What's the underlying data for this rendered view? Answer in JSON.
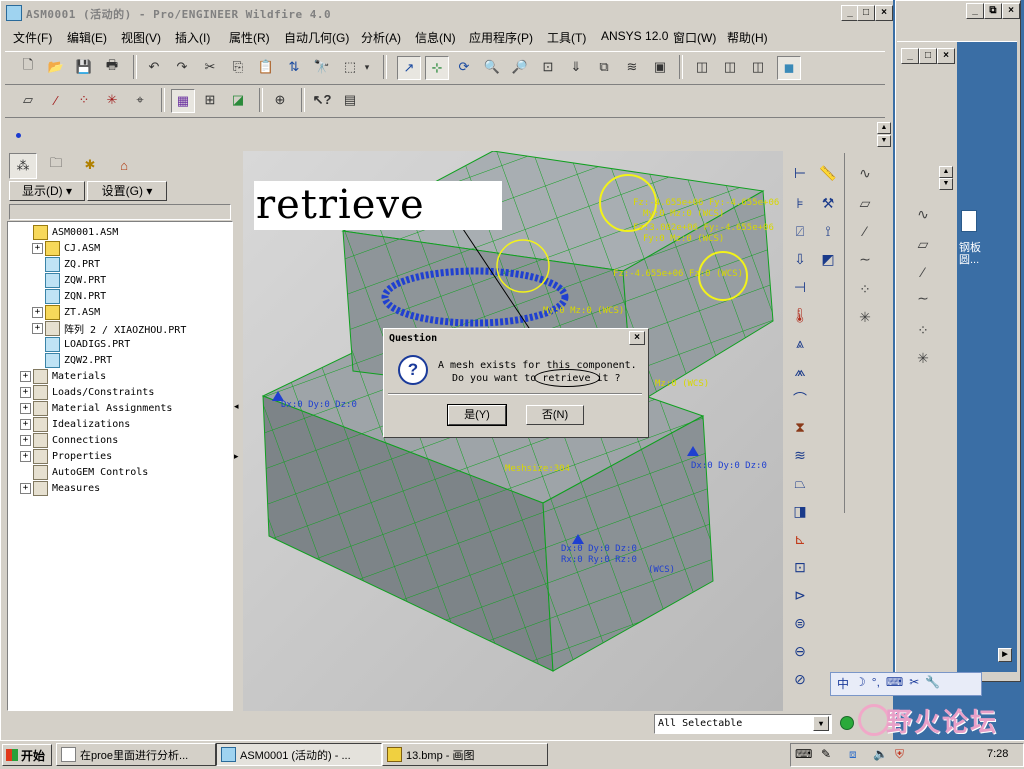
{
  "window": {
    "title": "ASM0001 (活动的) - Pro/ENGINEER Wildfire 4.0",
    "controls": [
      "_",
      "□",
      "×"
    ]
  },
  "menu": [
    "文件(F)",
    "编辑(E)",
    "视图(V)",
    "插入(I)",
    "属性(R)",
    "自动几何(G)",
    "分析(A)",
    "信息(N)",
    "应用程序(P)",
    "工具(T)",
    "ANSYS 12.0",
    "窗口(W)",
    "帮助(H)"
  ],
  "navigator": {
    "show_btn": "显示(D) ▾",
    "settings_btn": "设置(G) ▾",
    "tree": [
      {
        "label": "ASM0001.ASM",
        "icon": "assembly-icon",
        "indent": 0,
        "expander": ""
      },
      {
        "label": "CJ.ASM",
        "icon": "assembly-icon",
        "indent": 1,
        "expander": "+"
      },
      {
        "label": "ZQ.PRT",
        "icon": "part-icon",
        "indent": 1,
        "expander": ""
      },
      {
        "label": "ZQW.PRT",
        "icon": "part-icon",
        "indent": 1,
        "expander": ""
      },
      {
        "label": "ZQN.PRT",
        "icon": "part-icon",
        "indent": 1,
        "expander": ""
      },
      {
        "label": "ZT.ASM",
        "icon": "assembly-icon",
        "indent": 1,
        "expander": "+"
      },
      {
        "label": "阵列 2 / XIAOZHOU.PRT",
        "icon": "pattern-icon",
        "indent": 1,
        "expander": "+"
      },
      {
        "label": "LOADIGS.PRT",
        "icon": "part-icon",
        "indent": 1,
        "expander": ""
      },
      {
        "label": "ZQW2.PRT",
        "icon": "part-icon",
        "indent": 1,
        "expander": ""
      },
      {
        "label": "Materials",
        "icon": "materials-icon",
        "indent": 0,
        "expander": "+"
      },
      {
        "label": "Loads/Constraints",
        "icon": "loads-icon",
        "indent": 0,
        "expander": "+"
      },
      {
        "label": "Material Assignments",
        "icon": "material-assign-icon",
        "indent": 0,
        "expander": "+"
      },
      {
        "label": "Idealizations",
        "icon": "idealization-icon",
        "indent": 0,
        "expander": "+"
      },
      {
        "label": "Connections",
        "icon": "connection-icon",
        "indent": 0,
        "expander": "+"
      },
      {
        "label": "Properties",
        "icon": "properties-icon",
        "indent": 0,
        "expander": "+"
      },
      {
        "label": "AutoGEM Controls",
        "icon": "autogem-icon",
        "indent": 0,
        "expander": ""
      },
      {
        "label": "Measures",
        "icon": "measures-icon",
        "indent": 0,
        "expander": "+"
      }
    ]
  },
  "annotation": {
    "text": "retrieve"
  },
  "dialog": {
    "title": "Question",
    "line1": "A mesh exists for this component.",
    "line2": "Do you want to retrieve it ?",
    "yes_button": "是(Y)",
    "no_button": "否(N)"
  },
  "viewport": {
    "labels": [
      "Fz:-4.655e+06 Fy:-4.655e+06 Fz:0",
      "My:0 Mz:0 (WCS)",
      "Fz:3.002e+06 Fy:-4.655e+06",
      "Fy:0 Mz:0 (WCS)",
      "Fz:-4.655e+06 Fz:0 (WCS)",
      "My:0 Mz:0 (WCS)",
      "Mz:0 (WCS)",
      "Dx:0 Dy:0 Dz:0",
      "Dx:0 Dy:0 Dz:0",
      "(WCS)",
      "Dx:0 Dy:0 Dz:0",
      "Rx:0 Ry:0 Rz:0",
      "Meshsize:304"
    ],
    "status_text": "All Selectable"
  },
  "right_window": {
    "desktop_icon_label": "钢板\n圆..."
  },
  "ime": {
    "items": [
      "中",
      "☽",
      "°,",
      "⌨",
      "✂",
      "🔧"
    ]
  },
  "watermark": "野火论坛",
  "taskbar": {
    "start": "开始",
    "tasks": [
      "在proe里面进行分析...",
      "ASM0001 (活动的) - ...",
      "13.bmp - 画图"
    ],
    "clock": "7:28"
  },
  "colors": {
    "titlebar": "#d4d0c8",
    "viewport_bg": "#c8c8c8",
    "mesh": "#0fa81a",
    "highlight": "#f2f21a",
    "desktop": "#3a6ea5",
    "constraint": "#2040d0"
  }
}
